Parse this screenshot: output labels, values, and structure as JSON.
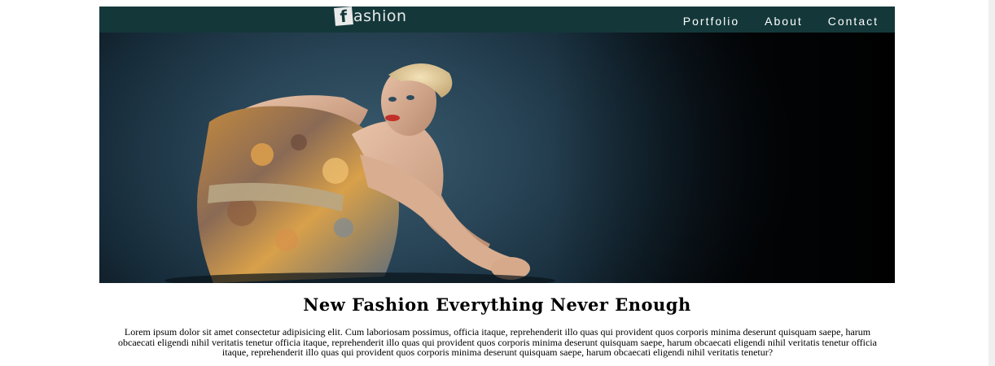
{
  "brand": {
    "logo_letter": "f",
    "logo_text": "ashion"
  },
  "nav": {
    "items": [
      {
        "label": "Portfolio"
      },
      {
        "label": "About"
      },
      {
        "label": "Contact"
      }
    ]
  },
  "hero": {
    "image_alt_icon": "fashion-model-photo"
  },
  "content": {
    "headline": "New Fashion Everything Never Enough",
    "paragraph": "Lorem ipsum dolor sit amet consectetur adipisicing elit. Cum laboriosam possimus, officia itaque, reprehenderit illo quas qui provident quos corporis minima deserunt quisquam saepe, harum obcaecati eligendi nihil veritatis tenetur officia itaque, reprehenderit illo quas qui provident quos corporis minima deserunt quisquam saepe, harum obcaecati eligendi nihil veritatis tenetur officia itaque, reprehenderit illo quas qui provident quos corporis minima deserunt quisquam saepe, harum obcaecati eligendi nihil veritatis tenetur?"
  },
  "colors": {
    "navbar": "#14383a",
    "background": "#ffffff",
    "text": "#000000"
  }
}
